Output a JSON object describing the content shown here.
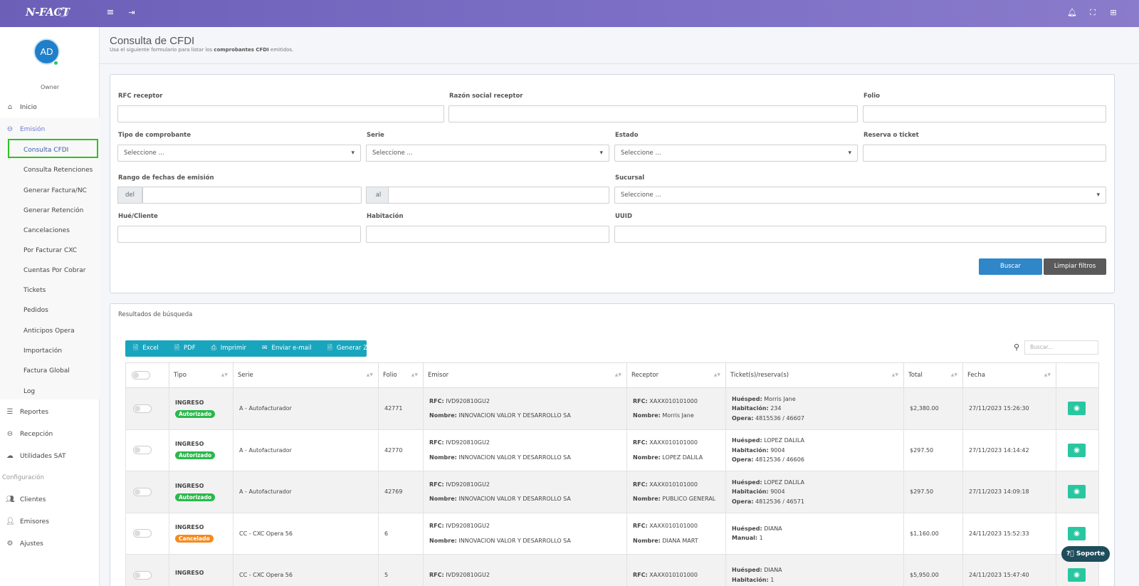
{
  "app": {
    "logo": "N-FACT"
  },
  "topbar": {
    "menu_icon": "menu-icon",
    "logout_icon": "logout-icon",
    "bell_icon": "bell-icon",
    "expand_icon": "expand-icon",
    "grid_icon": "grid-icon"
  },
  "user": {
    "initials": "AD",
    "role": "Owner"
  },
  "sidebar": {
    "inicio": "Inicio",
    "emision": "Emisión",
    "submenu": [
      "Consulta CFDI",
      "Consulta Retenciones",
      "Generar Factura/NC",
      "Generar Retención",
      "Cancelaciones",
      "Por Facturar CXC",
      "Cuentas Por Cobrar",
      "Tickets",
      "Pedidos",
      "Anticipos Opera",
      "Importación",
      "Factura Global",
      "Log"
    ],
    "reportes": "Reportes",
    "recepcion": "Recepción",
    "utilidades": "Utilidades SAT",
    "config_label": "Configuración",
    "clientes": "Clientes",
    "emisores": "Emisores",
    "ajustes": "Ajustes"
  },
  "page": {
    "title": "Consulta de CFDI",
    "subtitle_pre": "Usa el siguiente formulario para listar los ",
    "subtitle_bold": "comprobantes CFDI",
    "subtitle_post": " emitidos."
  },
  "filters": {
    "rfc": "RFC receptor",
    "razon": "Razón social receptor",
    "folio": "Folio",
    "tipo": "Tipo de comprobante",
    "serie": "Serie",
    "estado": "Estado",
    "reserva": "Reserva o ticket",
    "rango": "Rango de fechas de emisión",
    "del": "del",
    "al": "al",
    "sucursal": "Sucursal",
    "huesped": "Hué/Cliente",
    "habitacion": "Habitación",
    "uuid": "UUID",
    "select_placeholder": "Seleccione ...",
    "buscar": "Buscar",
    "limpiar": "Limpiar filtros"
  },
  "results": {
    "title": "Resultados de búsqueda",
    "export": {
      "excel": "Excel",
      "pdf": "PDF",
      "imprimir": "Imprimir",
      "email": "Enviar e-mail",
      "zip": "Generar ZIP"
    },
    "search_placeholder": "Buscar...",
    "columns": [
      "Tipo",
      "Serie",
      "Folio",
      "Emisor",
      "Receptor",
      "Ticket(s)/reserva(s)",
      "Total",
      "Fecha"
    ],
    "rows": [
      {
        "tipo": "INGRESO",
        "status": "Autorizado",
        "serie": "A - Autofacturador",
        "folio": "42771",
        "rfc_emisor": "IVD920810GU2",
        "nombre_emisor": "INNOVACION VALOR Y DESARROLLO SA",
        "rfc_receptor": "XAXX010101000",
        "nombre_receptor": "Morris Jane",
        "ticket": [
          "Huésped:",
          "Morris Jane",
          "Habitación:",
          "234",
          "Opera:",
          "4815536 / 46607"
        ],
        "total": "$2,380.00",
        "fecha": "27/11/2023 15:26:30"
      },
      {
        "tipo": "INGRESO",
        "status": "Autorizado",
        "serie": "A - Autofacturador",
        "folio": "42770",
        "rfc_emisor": "IVD920810GU2",
        "nombre_emisor": "INNOVACION VALOR Y DESARROLLO SA",
        "rfc_receptor": "XAXX010101000",
        "nombre_receptor": "LOPEZ DALILA",
        "ticket": [
          "Huésped:",
          "LOPEZ DALILA",
          "Habitación:",
          "9004",
          "Opera:",
          "4812536 / 46606"
        ],
        "total": "$297.50",
        "fecha": "27/11/2023 14:14:42"
      },
      {
        "tipo": "INGRESO",
        "status": "Autorizado",
        "serie": "A - Autofacturador",
        "folio": "42769",
        "rfc_emisor": "IVD920810GU2",
        "nombre_emisor": "INNOVACION VALOR Y DESARROLLO SA",
        "rfc_receptor": "XAXX010101000",
        "nombre_receptor": "PUBLICO GENERAL",
        "ticket": [
          "Huésped:",
          "LOPEZ DALILA",
          "Habitación:",
          "9004",
          "Opera:",
          "4812536 / 46571"
        ],
        "total": "$297.50",
        "fecha": "27/11/2023 14:09:18"
      },
      {
        "tipo": "INGRESO",
        "status": "Cancelado",
        "serie": "CC - CXC Opera 56",
        "folio": "6",
        "rfc_emisor": "IVD920810GU2",
        "nombre_emisor": "INNOVACION VALOR Y DESARROLLO SA",
        "rfc_receptor": "XAXX010101000",
        "nombre_receptor": "DIANA MART",
        "ticket": [
          "Huésped:",
          "DIANA",
          "Manual:",
          "1",
          "",
          ""
        ],
        "total": "$1,160.00",
        "fecha": "24/11/2023 15:52:33"
      },
      {
        "tipo": "INGRESO",
        "status": "",
        "serie": "CC - CXC Opera 56",
        "folio": "5",
        "rfc_emisor": "IVD920810GU2",
        "nombre_emisor": "",
        "rfc_receptor": "XAXX010101000",
        "nombre_receptor": "",
        "ticket": [
          "Huésped:",
          "DIANA",
          "Habitación:",
          "1",
          "",
          ""
        ],
        "total": "$5,950.00",
        "fecha": "24/11/2023 15:47:40"
      }
    ]
  },
  "labels": {
    "rfc": "RFC:",
    "nombre": "Nombre:"
  },
  "soporte": "Soporte",
  "colors": {
    "primary": "#2f86c9",
    "secondary": "#5a5a5a",
    "export": "#1aa5be",
    "autorizado": "#2bb84b",
    "cancelado": "#f58a1f",
    "view": "#28c7a0",
    "highlight": "#2ec31d"
  }
}
